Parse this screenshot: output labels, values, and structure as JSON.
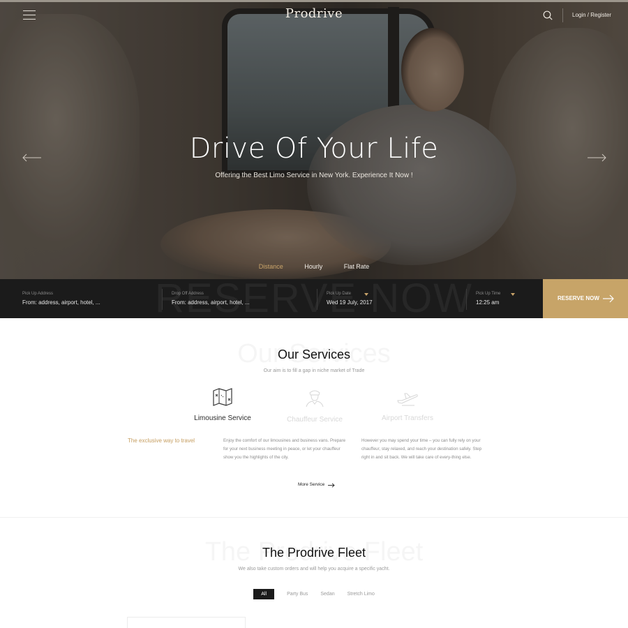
{
  "header": {
    "logo": "Prodrive",
    "login_label": "Login / Register"
  },
  "hero": {
    "title": "Drive Of Your Life",
    "subtitle": "Offering the Best Limo Service in New York. Experience It Now !",
    "tabs": [
      "Distance",
      "Hourly",
      "Flat Rate"
    ],
    "active_tab": "Distance"
  },
  "booking": {
    "ghost_text": "RESERVE NOW",
    "pickup_address": {
      "label": "Pick Up Address",
      "placeholder": "From: address, airport, hotel, ..."
    },
    "dropoff_address": {
      "label": "Drop Off Address",
      "placeholder": "From: address, airport, hotel, ..."
    },
    "pickup_date": {
      "label": "Pick Up Date",
      "value": "Wed 19 July, 2017"
    },
    "pickup_time": {
      "label": "Pick Up Time",
      "value": "12:25 am"
    },
    "reserve_label": "RESERVE NOW"
  },
  "services": {
    "ghost": "Our Services",
    "title": "Our Services",
    "subtitle": "Our aim is to fill a gap in niche market of Trade",
    "items": [
      {
        "name": "Limousine Service",
        "icon": "map-icon",
        "active": true
      },
      {
        "name": "Chauffeur Service",
        "icon": "chauffeur-icon",
        "active": false
      },
      {
        "name": "Airport Transfers",
        "icon": "airplane-icon",
        "active": false
      }
    ],
    "tagline": "The exclusive way to travel",
    "paragraph_1": "Enjoy the comfort of our limousines and business vans. Prepare for your next business meeting in peace, or let your chauffeur show you the highlights of the city.",
    "paragraph_2": "However you may spend your time – you can fully rely on your chauffeur, stay relaxed, and reach your destination safely. Step right in and sit back. We will take care of every-thing else.",
    "more_label": "More Service"
  },
  "fleet": {
    "ghost": "The Prodrive Fleet",
    "title": "The Prodrive Fleet",
    "subtitle": "We also take custom orders and will help you acquire a specific yacht.",
    "filters": [
      "All",
      "Party Bus",
      "Sedan",
      "Stretch Limo"
    ],
    "active_filter": "All"
  },
  "colors": {
    "accent_gold": "#c7a468",
    "dark_bar": "#1b1b1b",
    "text_dark": "#111111",
    "text_muted": "#8d8d8d"
  }
}
